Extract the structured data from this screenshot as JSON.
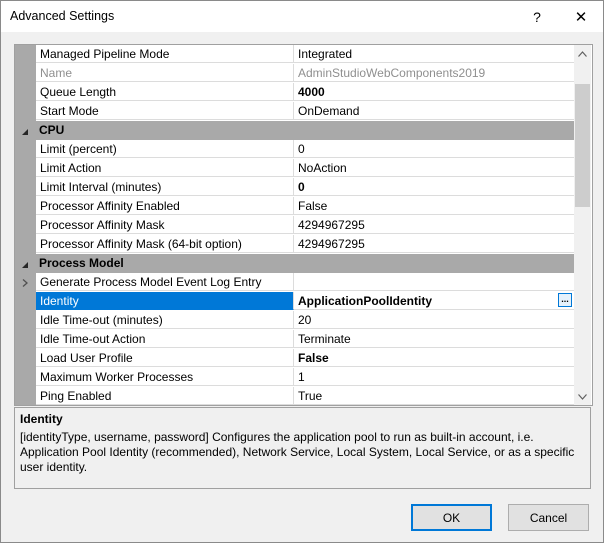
{
  "window": {
    "title": "Advanced Settings",
    "help_label": "?",
    "close_label": "✕"
  },
  "grid": {
    "rows": [
      {
        "kind": "prop",
        "name": "Managed Pipeline Mode",
        "value": "Integrated"
      },
      {
        "kind": "prop",
        "name": "Name",
        "value": "AdminStudioWebComponents2019",
        "disabled": true
      },
      {
        "kind": "prop",
        "name": "Queue Length",
        "value": "4000",
        "bold": true
      },
      {
        "kind": "prop",
        "name": "Start Mode",
        "value": "OnDemand"
      },
      {
        "kind": "category",
        "name": "CPU"
      },
      {
        "kind": "prop",
        "name": "Limit (percent)",
        "value": "0"
      },
      {
        "kind": "prop",
        "name": "Limit Action",
        "value": "NoAction"
      },
      {
        "kind": "prop",
        "name": "Limit Interval (minutes)",
        "value": "0",
        "bold": true
      },
      {
        "kind": "prop",
        "name": "Processor Affinity Enabled",
        "value": "False"
      },
      {
        "kind": "prop",
        "name": "Processor Affinity Mask",
        "value": "4294967295"
      },
      {
        "kind": "prop",
        "name": "Processor Affinity Mask (64-bit option)",
        "value": "4294967295"
      },
      {
        "kind": "category",
        "name": "Process Model"
      },
      {
        "kind": "prop",
        "name": "Generate Process Model Event Log Entry",
        "value": "",
        "expandable": true
      },
      {
        "kind": "prop",
        "name": "Identity",
        "value": "ApplicationPoolIdentity",
        "selected": true,
        "ellipsis": "..."
      },
      {
        "kind": "prop",
        "name": "Idle Time-out (minutes)",
        "value": "20"
      },
      {
        "kind": "prop",
        "name": "Idle Time-out Action",
        "value": "Terminate"
      },
      {
        "kind": "prop",
        "name": "Load User Profile",
        "value": "False",
        "bold": true
      },
      {
        "kind": "prop",
        "name": "Maximum Worker Processes",
        "value": "1"
      },
      {
        "kind": "prop",
        "name": "Ping Enabled",
        "value": "True"
      }
    ]
  },
  "description": {
    "title": "Identity",
    "text": "[identityType, username, password] Configures the application pool to run as built-in account, i.e. Application Pool Identity (recommended), Network Service, Local System, Local Service, or as a specific user identity."
  },
  "buttons": {
    "ok": "OK",
    "cancel": "Cancel"
  },
  "icons": {
    "expander": "collapse-triangle-icon",
    "row_marker": "expand-arrow-icon",
    "scroll_up": "scroll-up-arrow-icon",
    "scroll_down": "scroll-down-arrow-icon"
  },
  "colors": {
    "selection": "#0078d7",
    "category_bg": "#a9a9a9"
  }
}
